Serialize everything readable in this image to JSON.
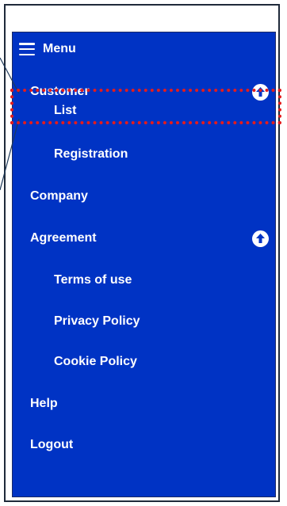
{
  "menu": {
    "title": "Menu",
    "colors": {
      "background": "#0033c4",
      "text": "#ffffff",
      "highlight": "#e41c1c"
    },
    "items": [
      {
        "label": "Customer",
        "level": 0,
        "expanded": true
      },
      {
        "label": "List",
        "level": 1,
        "highlighted": true
      },
      {
        "label": "Registration",
        "level": 1
      },
      {
        "label": "Company",
        "level": 0
      },
      {
        "label": "Agreement",
        "level": 0,
        "expanded": true
      },
      {
        "label": "Terms of use",
        "level": 1
      },
      {
        "label": "Privacy Policy",
        "level": 1
      },
      {
        "label": "Cookie Policy",
        "level": 1
      },
      {
        "label": "Help",
        "level": 0
      },
      {
        "label": "Logout",
        "level": 0
      }
    ]
  },
  "icons": {
    "menu": "hamburger-icon",
    "collapse": "arrow-up-icon"
  }
}
